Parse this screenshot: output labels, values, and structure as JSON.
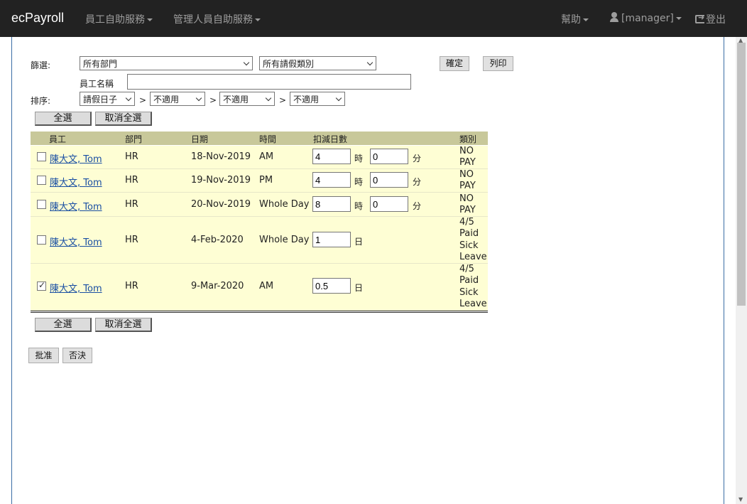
{
  "navbar": {
    "brand": "ecPayroll",
    "menu_employee": "員工自助服務",
    "menu_manager": "管理人員自助服務",
    "help": "幫助",
    "user": "[manager]",
    "logout": "登出"
  },
  "filter": {
    "label": "篩選:",
    "department": "所有部門",
    "leave_type": "所有請假類別",
    "confirm": "確定",
    "print": "列印",
    "employee_name_label": "員工名稱",
    "employee_name_value": ""
  },
  "sort": {
    "label": "排序:",
    "first": "請假日子",
    "second": "不適用",
    "third": "不適用",
    "fourth": "不適用",
    "sep": ">"
  },
  "select_all": "全選",
  "deselect_all": "取消全選",
  "table": {
    "headers": {
      "employee": "員工",
      "department": "部門",
      "date": "日期",
      "time": "時間",
      "deduct_days": "扣減日數",
      "category": "類別"
    },
    "units": {
      "hour": "時",
      "minute": "分",
      "day": "日"
    },
    "rows": [
      {
        "checked": false,
        "employee": "陳大文, Tom",
        "department": "HR",
        "date": "18-Nov-2019",
        "time": "AM",
        "hours": "4",
        "minutes": "0",
        "category": [
          "NO",
          "PAY"
        ]
      },
      {
        "checked": false,
        "employee": "陳大文, Tom",
        "department": "HR",
        "date": "19-Nov-2019",
        "time": "PM",
        "hours": "4",
        "minutes": "0",
        "category": [
          "NO",
          "PAY"
        ]
      },
      {
        "checked": false,
        "employee": "陳大文, Tom",
        "department": "HR",
        "date": "20-Nov-2019",
        "time": "Whole Day",
        "hours": "8",
        "minutes": "0",
        "category": [
          "NO",
          "PAY"
        ]
      },
      {
        "checked": false,
        "employee": "陳大文, Tom",
        "department": "HR",
        "date": "4-Feb-2020",
        "time": "Whole Day",
        "days": "1",
        "category": [
          "4/5",
          "Paid",
          "Sick",
          "Leave"
        ]
      },
      {
        "checked": true,
        "employee": "陳大文, Tom",
        "department": "HR",
        "date": "9-Mar-2020",
        "time": "AM",
        "days": "0.5",
        "category": [
          "4/5",
          "Paid",
          "Sick",
          "Leave"
        ]
      }
    ]
  },
  "actions": {
    "approve": "批准",
    "reject": "否決"
  }
}
